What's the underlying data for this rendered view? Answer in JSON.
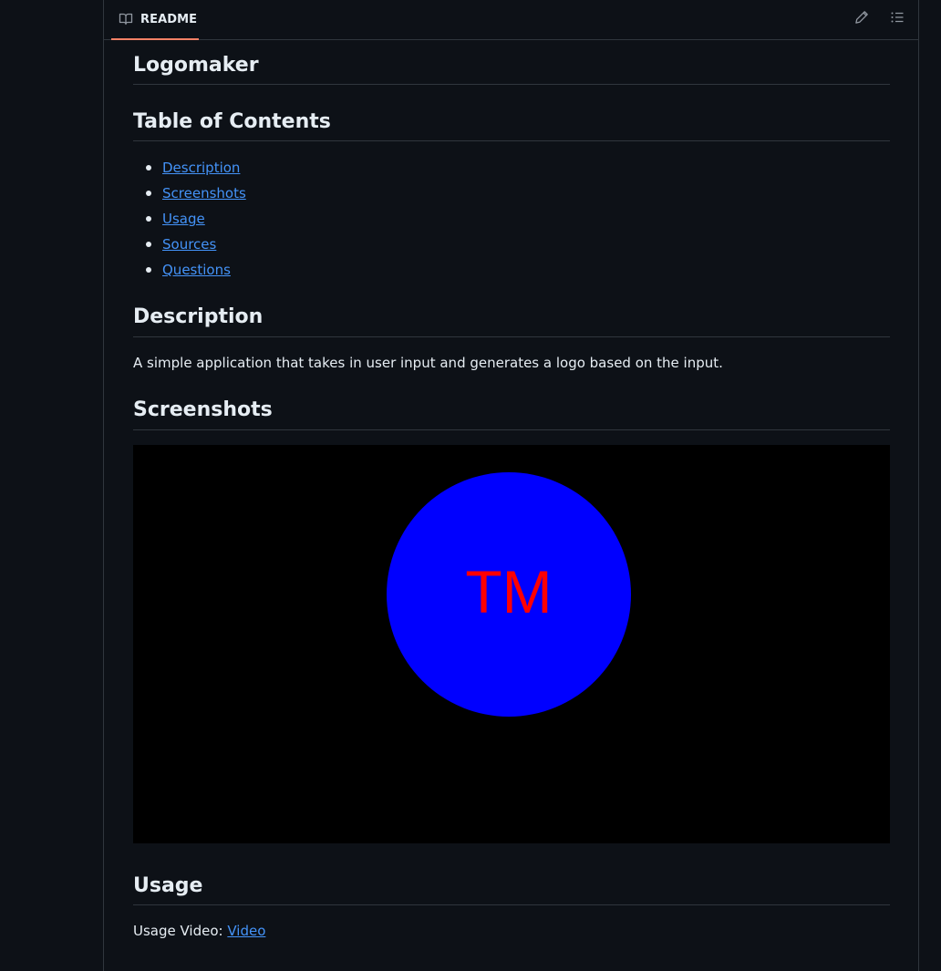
{
  "header": {
    "tab_label": "README",
    "icons": [
      "book-icon",
      "pencil-icon",
      "list-unordered-icon"
    ]
  },
  "readme": {
    "title": "Logomaker",
    "toc_heading": "Table of Contents",
    "toc": [
      {
        "label": "Description"
      },
      {
        "label": "Screenshots"
      },
      {
        "label": "Usage"
      },
      {
        "label": "Sources"
      },
      {
        "label": "Questions"
      }
    ],
    "description_heading": "Description",
    "description_text": "A simple application that takes in user input and generates a logo based on the input.",
    "screenshots_heading": "Screenshots",
    "screenshot": {
      "logo_text": "TM",
      "background_color": "#000000",
      "shape_color": "#0000ff",
      "text_color": "#ff0000"
    },
    "usage_heading": "Usage",
    "usage_prefix": "Usage Video: ",
    "usage_link": "Video"
  },
  "colors": {
    "page_bg": "#0d1117",
    "border": "#30363d",
    "link": "#4493f8",
    "tab_underline": "#f78166",
    "text": "#e6edf3"
  }
}
